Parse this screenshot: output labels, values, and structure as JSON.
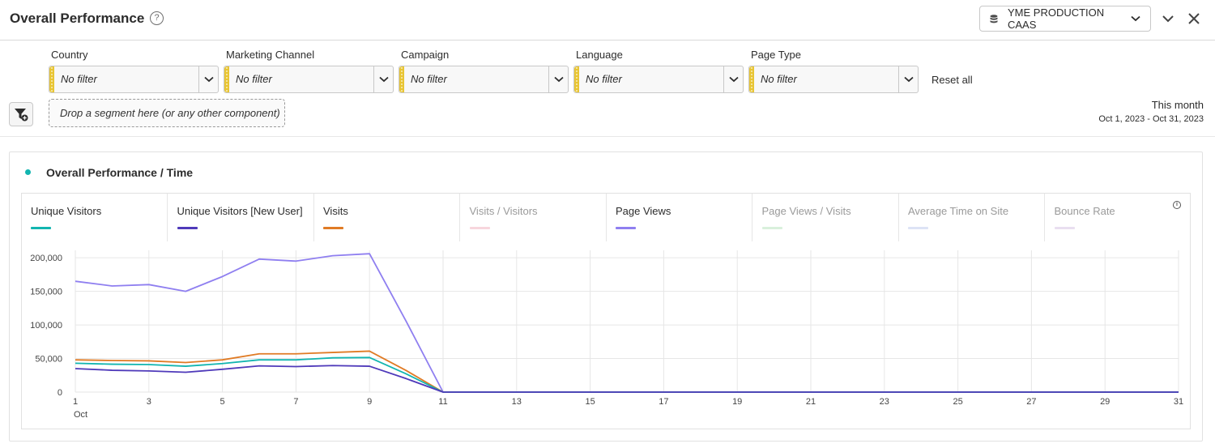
{
  "header": {
    "title": "Overall Performance",
    "help_symbol": "?",
    "report_suite": "YME PRODUCTION CAAS"
  },
  "filters": [
    {
      "label": "Country",
      "value": "No filter"
    },
    {
      "label": "Marketing Channel",
      "value": "No filter"
    },
    {
      "label": "Campaign",
      "value": "No filter"
    },
    {
      "label": "Language",
      "value": "No filter"
    },
    {
      "label": "Page Type",
      "value": "No filter"
    }
  ],
  "reset_all": "Reset all",
  "segment_drop": "Drop a segment here (or any other component)",
  "date": {
    "title": "This month",
    "range": "Oct 1, 2023 - Oct 31, 2023"
  },
  "panel": {
    "title": "Overall Performance / Time",
    "dot_color": "#12b5b0"
  },
  "metrics": [
    {
      "name": "Unique Visitors",
      "color": "#12b5b0",
      "active": true
    },
    {
      "name": "Unique Visitors [New User]",
      "color": "#4f3aba",
      "active": true
    },
    {
      "name": "Visits",
      "color": "#e07b25",
      "active": true
    },
    {
      "name": "Visits / Visitors",
      "color": "#f7d6dd",
      "active": false
    },
    {
      "name": "Page Views",
      "color": "#8f7ff0",
      "active": true
    },
    {
      "name": "Page Views / Visits",
      "color": "#d9f0dc",
      "active": false
    },
    {
      "name": "Average Time on Site",
      "color": "#dde3f5",
      "active": false
    },
    {
      "name": "Bounce Rate",
      "color": "#e9dff0",
      "active": false
    }
  ],
  "chart_data": {
    "type": "line",
    "x": [
      1,
      2,
      3,
      4,
      5,
      6,
      7,
      8,
      9,
      10,
      11,
      12,
      13,
      14,
      15,
      16,
      17,
      18,
      19,
      20,
      21,
      22,
      23,
      24,
      25,
      26,
      27,
      28,
      29,
      30,
      31
    ],
    "x_tick_labels": [
      "1",
      "3",
      "5",
      "7",
      "9",
      "11",
      "13",
      "15",
      "17",
      "19",
      "21",
      "23",
      "25",
      "27",
      "29",
      "31"
    ],
    "x_sublabel": "Oct",
    "ylim": [
      0,
      205000
    ],
    "y_tick_labels": [
      "0",
      "50,000",
      "100,000",
      "150,000",
      "200,000"
    ],
    "grid": true,
    "series": [
      {
        "name": "Page Views",
        "color": "#8f7ff0",
        "values": [
          165000,
          158000,
          160000,
          150000,
          172000,
          198000,
          195000,
          203000,
          206000,
          105000,
          0,
          0,
          0,
          0,
          0,
          0,
          0,
          0,
          0,
          0,
          0,
          0,
          0,
          0,
          0,
          0,
          0,
          0,
          0,
          0,
          0
        ]
      },
      {
        "name": "Visits",
        "color": "#e07b25",
        "values": [
          48000,
          47000,
          46500,
          44000,
          48000,
          57000,
          57000,
          59000,
          61000,
          32000,
          0,
          0,
          0,
          0,
          0,
          0,
          0,
          0,
          0,
          0,
          0,
          0,
          0,
          0,
          0,
          0,
          0,
          0,
          0,
          0,
          0
        ]
      },
      {
        "name": "Unique Visitors",
        "color": "#12b5b0",
        "values": [
          43000,
          41500,
          41000,
          38500,
          42500,
          48000,
          48000,
          51000,
          51500,
          27000,
          0,
          0,
          0,
          0,
          0,
          0,
          0,
          0,
          0,
          0,
          0,
          0,
          0,
          0,
          0,
          0,
          0,
          0,
          0,
          0,
          0
        ]
      },
      {
        "name": "Unique Visitors [New User]",
        "color": "#4f3aba",
        "values": [
          35000,
          32500,
          31500,
          29500,
          34000,
          39000,
          38000,
          39500,
          38500,
          20000,
          0,
          0,
          0,
          0,
          0,
          0,
          0,
          0,
          0,
          0,
          0,
          0,
          0,
          0,
          0,
          0,
          0,
          0,
          0,
          0,
          0
        ]
      }
    ]
  }
}
